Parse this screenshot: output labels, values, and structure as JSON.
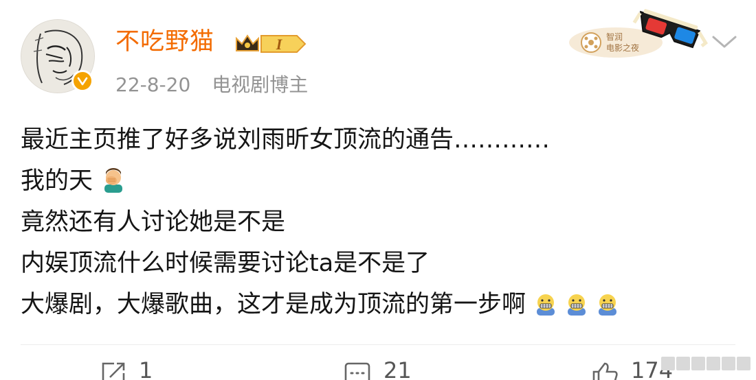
{
  "post": {
    "author": {
      "username": "不吃野猫",
      "level_badge_text": "I",
      "verified_icon": "verified-badge-icon",
      "avatar_icon": "sketch-face-avatar"
    },
    "meta": {
      "date": "22-8-20",
      "role": "电视剧博主"
    },
    "promo_badge": {
      "text_line1": "智润",
      "text_line2": "电影之夜",
      "icon": "3d-glasses-icon"
    },
    "content_lines": [
      {
        "text": "最近主页推了好多说刘雨昕女顶流的通告…………",
        "emoji": []
      },
      {
        "text": "我的天",
        "emoji": [
          "facepalm-man-emoji"
        ]
      },
      {
        "text": "竟然还有人讨论她是不是",
        "emoji": []
      },
      {
        "text": "内娱顶流什么时候需要讨论ta是不是了",
        "emoji": []
      },
      {
        "text": "大爆剧，大爆歌曲，这才是成为顶流的第一步啊",
        "emoji": [
          "grimace-emoji",
          "grimace-emoji",
          "grimace-emoji"
        ]
      }
    ],
    "actions": {
      "share_count": "1",
      "comment_count": "21",
      "like_count": "174"
    }
  },
  "colors": {
    "username": "#f36b00",
    "meta_text": "#939393",
    "body_text": "#151515",
    "verified": "#f5a300",
    "level_badge_gold": "#e8a33a"
  }
}
